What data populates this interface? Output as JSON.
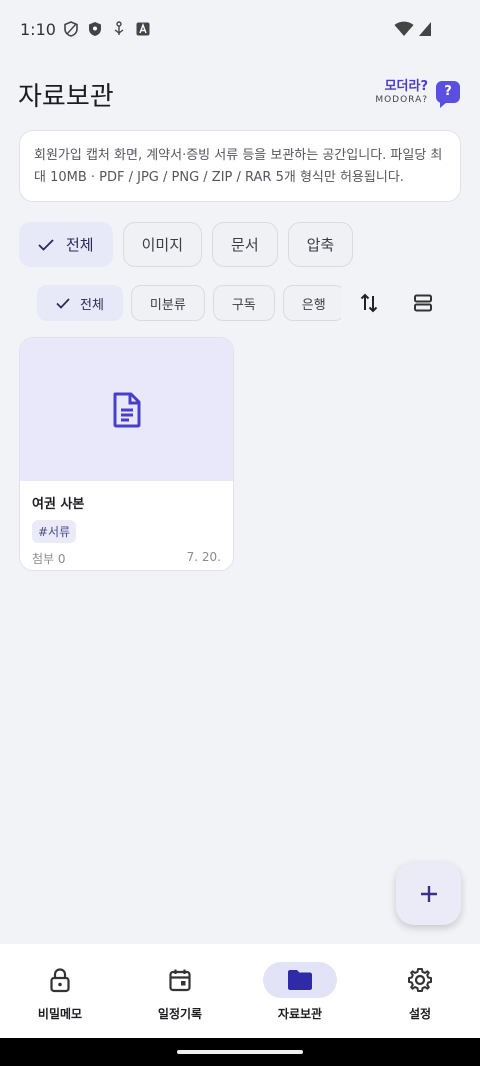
{
  "status": {
    "time": "1:10"
  },
  "header": {
    "title": "자료보관",
    "help_title": "모더라?",
    "help_sub": "MODORA?",
    "help_badge": "?"
  },
  "info": {
    "text": "회원가입 캡처 화면, 계약서·증빙 서류 등을 보관하는 공간입니다. 파일당 최대 10MB · PDF / JPG / PNG / ZIP / RAR 5개 형식만 허용됩니다."
  },
  "type_filters": [
    {
      "label": "전체",
      "selected": true
    },
    {
      "label": "이미지",
      "selected": false
    },
    {
      "label": "문서",
      "selected": false
    },
    {
      "label": "압축",
      "selected": false
    }
  ],
  "category_filters": [
    {
      "label": "전체",
      "selected": true
    },
    {
      "label": "미분류",
      "selected": false
    },
    {
      "label": "구독",
      "selected": false
    },
    {
      "label": "은행",
      "selected": false
    }
  ],
  "documents": [
    {
      "title": "여권 사본",
      "tag": "#서류",
      "attachments": "첨부 0",
      "date": "7. 20.",
      "icon": "document-icon"
    }
  ],
  "fab": {
    "icon": "plus-icon"
  },
  "nav": [
    {
      "label": "비밀메모",
      "icon": "lock-icon",
      "active": false
    },
    {
      "label": "일정기록",
      "icon": "calendar-icon",
      "active": false
    },
    {
      "label": "자료보관",
      "icon": "folder-icon",
      "active": true
    },
    {
      "label": "설정",
      "icon": "gear-icon",
      "active": false
    }
  ],
  "colors": {
    "accent": "#4a3ec8",
    "accent_soft": "#e7e8f8",
    "background": "#f2f3f7"
  }
}
